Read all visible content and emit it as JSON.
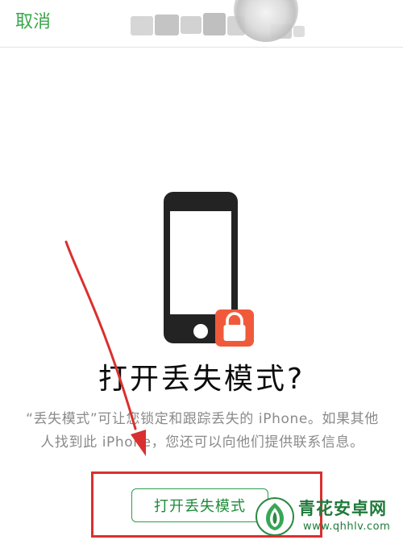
{
  "navbar": {
    "cancel_label": "取消"
  },
  "main": {
    "title": "打开丢失模式?",
    "description": "“丢失模式”可让您锁定和跟踪丢失的 iPhone。如果其他人找到此 iPhone，您还可以向他们提供联系信息。",
    "enable_button_label": "打开丢失模式"
  },
  "icons": {
    "phone": "iphone-icon",
    "lock": "lock-icon",
    "arrow": "annotation-arrow",
    "watermark_logo": "qinghua-logo-icon"
  },
  "watermark": {
    "name": "青花安卓网",
    "url": "www.qhhlv.com"
  },
  "colors": {
    "accent_green": "#3aa84a",
    "button_green": "#1e8a3a",
    "lock_badge": "#f05a3a",
    "annotation_red": "#d9302f",
    "phone_body": "#232323"
  }
}
